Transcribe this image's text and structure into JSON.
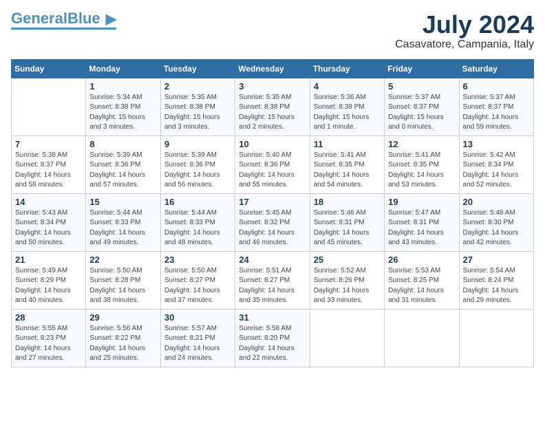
{
  "header": {
    "logo_general": "General",
    "logo_blue": "Blue",
    "month_title": "July 2024",
    "location": "Casavatore, Campania, Italy"
  },
  "days_of_week": [
    "Sunday",
    "Monday",
    "Tuesday",
    "Wednesday",
    "Thursday",
    "Friday",
    "Saturday"
  ],
  "weeks": [
    [
      {
        "day": "",
        "sunrise": "",
        "sunset": "",
        "daylight": ""
      },
      {
        "day": "1",
        "sunrise": "Sunrise: 5:34 AM",
        "sunset": "Sunset: 8:38 PM",
        "daylight": "Daylight: 15 hours and 3 minutes."
      },
      {
        "day": "2",
        "sunrise": "Sunrise: 5:35 AM",
        "sunset": "Sunset: 8:38 PM",
        "daylight": "Daylight: 15 hours and 3 minutes."
      },
      {
        "day": "3",
        "sunrise": "Sunrise: 5:35 AM",
        "sunset": "Sunset: 8:38 PM",
        "daylight": "Daylight: 15 hours and 2 minutes."
      },
      {
        "day": "4",
        "sunrise": "Sunrise: 5:36 AM",
        "sunset": "Sunset: 8:38 PM",
        "daylight": "Daylight: 15 hours and 1 minute."
      },
      {
        "day": "5",
        "sunrise": "Sunrise: 5:37 AM",
        "sunset": "Sunset: 8:37 PM",
        "daylight": "Daylight: 15 hours and 0 minutes."
      },
      {
        "day": "6",
        "sunrise": "Sunrise: 5:37 AM",
        "sunset": "Sunset: 8:37 PM",
        "daylight": "Daylight: 14 hours and 59 minutes."
      }
    ],
    [
      {
        "day": "7",
        "sunrise": "Sunrise: 5:38 AM",
        "sunset": "Sunset: 8:37 PM",
        "daylight": "Daylight: 14 hours and 58 minutes."
      },
      {
        "day": "8",
        "sunrise": "Sunrise: 5:39 AM",
        "sunset": "Sunset: 8:36 PM",
        "daylight": "Daylight: 14 hours and 57 minutes."
      },
      {
        "day": "9",
        "sunrise": "Sunrise: 5:39 AM",
        "sunset": "Sunset: 8:36 PM",
        "daylight": "Daylight: 14 hours and 56 minutes."
      },
      {
        "day": "10",
        "sunrise": "Sunrise: 5:40 AM",
        "sunset": "Sunset: 8:36 PM",
        "daylight": "Daylight: 14 hours and 55 minutes."
      },
      {
        "day": "11",
        "sunrise": "Sunrise: 5:41 AM",
        "sunset": "Sunset: 8:35 PM",
        "daylight": "Daylight: 14 hours and 54 minutes."
      },
      {
        "day": "12",
        "sunrise": "Sunrise: 5:41 AM",
        "sunset": "Sunset: 8:35 PM",
        "daylight": "Daylight: 14 hours and 53 minutes."
      },
      {
        "day": "13",
        "sunrise": "Sunrise: 5:42 AM",
        "sunset": "Sunset: 8:34 PM",
        "daylight": "Daylight: 14 hours and 52 minutes."
      }
    ],
    [
      {
        "day": "14",
        "sunrise": "Sunrise: 5:43 AM",
        "sunset": "Sunset: 8:34 PM",
        "daylight": "Daylight: 14 hours and 50 minutes."
      },
      {
        "day": "15",
        "sunrise": "Sunrise: 5:44 AM",
        "sunset": "Sunset: 8:33 PM",
        "daylight": "Daylight: 14 hours and 49 minutes."
      },
      {
        "day": "16",
        "sunrise": "Sunrise: 5:44 AM",
        "sunset": "Sunset: 8:33 PM",
        "daylight": "Daylight: 14 hours and 48 minutes."
      },
      {
        "day": "17",
        "sunrise": "Sunrise: 5:45 AM",
        "sunset": "Sunset: 8:32 PM",
        "daylight": "Daylight: 14 hours and 46 minutes."
      },
      {
        "day": "18",
        "sunrise": "Sunrise: 5:46 AM",
        "sunset": "Sunset: 8:31 PM",
        "daylight": "Daylight: 14 hours and 45 minutes."
      },
      {
        "day": "19",
        "sunrise": "Sunrise: 5:47 AM",
        "sunset": "Sunset: 8:31 PM",
        "daylight": "Daylight: 14 hours and 43 minutes."
      },
      {
        "day": "20",
        "sunrise": "Sunrise: 5:48 AM",
        "sunset": "Sunset: 8:30 PM",
        "daylight": "Daylight: 14 hours and 42 minutes."
      }
    ],
    [
      {
        "day": "21",
        "sunrise": "Sunrise: 5:49 AM",
        "sunset": "Sunset: 8:29 PM",
        "daylight": "Daylight: 14 hours and 40 minutes."
      },
      {
        "day": "22",
        "sunrise": "Sunrise: 5:50 AM",
        "sunset": "Sunset: 8:28 PM",
        "daylight": "Daylight: 14 hours and 38 minutes."
      },
      {
        "day": "23",
        "sunrise": "Sunrise: 5:50 AM",
        "sunset": "Sunset: 8:27 PM",
        "daylight": "Daylight: 14 hours and 37 minutes."
      },
      {
        "day": "24",
        "sunrise": "Sunrise: 5:51 AM",
        "sunset": "Sunset: 8:27 PM",
        "daylight": "Daylight: 14 hours and 35 minutes."
      },
      {
        "day": "25",
        "sunrise": "Sunrise: 5:52 AM",
        "sunset": "Sunset: 8:26 PM",
        "daylight": "Daylight: 14 hours and 33 minutes."
      },
      {
        "day": "26",
        "sunrise": "Sunrise: 5:53 AM",
        "sunset": "Sunset: 8:25 PM",
        "daylight": "Daylight: 14 hours and 31 minutes."
      },
      {
        "day": "27",
        "sunrise": "Sunrise: 5:54 AM",
        "sunset": "Sunset: 8:24 PM",
        "daylight": "Daylight: 14 hours and 29 minutes."
      }
    ],
    [
      {
        "day": "28",
        "sunrise": "Sunrise: 5:55 AM",
        "sunset": "Sunset: 8:23 PM",
        "daylight": "Daylight: 14 hours and 27 minutes."
      },
      {
        "day": "29",
        "sunrise": "Sunrise: 5:56 AM",
        "sunset": "Sunset: 8:22 PM",
        "daylight": "Daylight: 14 hours and 25 minutes."
      },
      {
        "day": "30",
        "sunrise": "Sunrise: 5:57 AM",
        "sunset": "Sunset: 8:21 PM",
        "daylight": "Daylight: 14 hours and 24 minutes."
      },
      {
        "day": "31",
        "sunrise": "Sunrise: 5:58 AM",
        "sunset": "Sunset: 8:20 PM",
        "daylight": "Daylight: 14 hours and 22 minutes."
      },
      {
        "day": "",
        "sunrise": "",
        "sunset": "",
        "daylight": ""
      },
      {
        "day": "",
        "sunrise": "",
        "sunset": "",
        "daylight": ""
      },
      {
        "day": "",
        "sunrise": "",
        "sunset": "",
        "daylight": ""
      }
    ]
  ]
}
